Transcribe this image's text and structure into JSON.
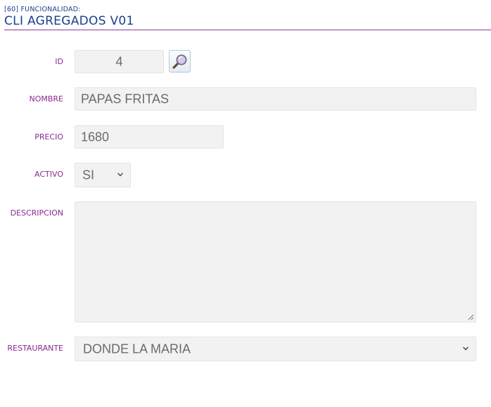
{
  "header": {
    "code": "[60] FUNCIONALIDAD:",
    "title": "CLI AGREGADOS V01"
  },
  "form": {
    "id": {
      "label": "ID",
      "value": "4"
    },
    "nombre": {
      "label": "NOMBRE",
      "value": "PAPAS FRITAS"
    },
    "precio": {
      "label": "PRECIO",
      "value": "1680"
    },
    "activo": {
      "label": "ACTIVO",
      "value": "SI"
    },
    "descripcion": {
      "label": "DESCRIPCION",
      "value": ""
    },
    "restaurante": {
      "label": "RESTAURANTE",
      "value": "DONDE LA MARIA"
    }
  },
  "icons": {
    "search": "magnifier-icon",
    "dropdown": "chevron-down-icon",
    "resize": "resize-grip-icon"
  },
  "colors": {
    "title": "#1a3f8f",
    "label": "#8a2a92",
    "divider": "#8e3c9a",
    "field_bg": "#f2f2f2"
  }
}
